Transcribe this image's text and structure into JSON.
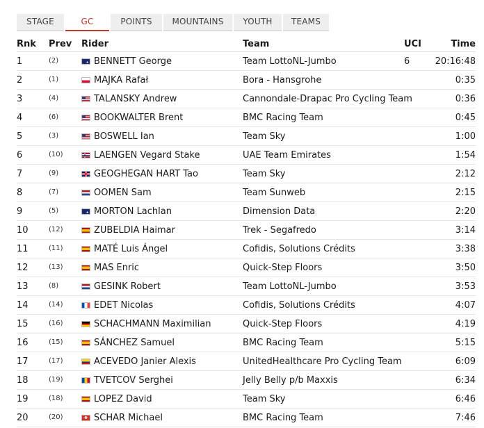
{
  "tabs": [
    {
      "label": "STAGE",
      "width": 68
    },
    {
      "label": "GC",
      "width": 63,
      "active": true
    },
    {
      "label": "POINTS",
      "width": 74
    },
    {
      "label": "MOUNTAINS",
      "width": 99
    },
    {
      "label": "YOUTH",
      "width": 69
    },
    {
      "label": "TEAMS",
      "width": 66
    }
  ],
  "columns": {
    "rnk": "Rnk",
    "prev": "Prev",
    "rider": "Rider",
    "team": "Team",
    "uci": "UCI",
    "time": "Time"
  },
  "rows": [
    {
      "rnk": "1",
      "prev": "(2)",
      "flag": "australia-flag-icon",
      "rider": "BENNETT George",
      "team": "Team LottoNL-Jumbo",
      "uci": "6",
      "time": "20:16:48"
    },
    {
      "rnk": "2",
      "prev": "(1)",
      "flag": "poland-flag-icon",
      "rider": "MAJKA Rafał",
      "team": "Bora - Hansgrohe",
      "uci": "",
      "time": "0:35"
    },
    {
      "rnk": "3",
      "prev": "(4)",
      "flag": "usa-flag-icon",
      "rider": "TALANSKY Andrew",
      "team": "Cannondale-Drapac Pro Cycling Team",
      "uci": "",
      "time": "0:36"
    },
    {
      "rnk": "4",
      "prev": "(6)",
      "flag": "usa-flag-icon",
      "rider": "BOOKWALTER Brent",
      "team": "BMC Racing Team",
      "uci": "",
      "time": "0:45"
    },
    {
      "rnk": "5",
      "prev": "(3)",
      "flag": "usa-flag-icon",
      "rider": "BOSWELL Ian",
      "team": "Team Sky",
      "uci": "",
      "time": "1:00"
    },
    {
      "rnk": "6",
      "prev": "(10)",
      "flag": "norway-flag-icon",
      "rider": "LAENGEN Vegard Stake",
      "team": "UAE Team Emirates",
      "uci": "",
      "time": "1:54"
    },
    {
      "rnk": "7",
      "prev": "(9)",
      "flag": "uk-flag-icon",
      "rider": "GEOGHEGAN HART Tao",
      "team": "Team Sky",
      "uci": "",
      "time": "2:12"
    },
    {
      "rnk": "8",
      "prev": "(7)",
      "flag": "netherlands-flag-icon",
      "rider": "OOMEN Sam",
      "team": "Team Sunweb",
      "uci": "",
      "time": "2:15"
    },
    {
      "rnk": "9",
      "prev": "(5)",
      "flag": "australia-flag-icon",
      "rider": "MORTON Lachlan",
      "team": "Dimension Data",
      "uci": "",
      "time": "2:20"
    },
    {
      "rnk": "10",
      "prev": "(12)",
      "flag": "spain-flag-icon",
      "rider": "ZUBELDIA Haimar",
      "team": "Trek - Segafredo",
      "uci": "",
      "time": "3:14"
    },
    {
      "rnk": "11",
      "prev": "(11)",
      "flag": "spain-flag-icon",
      "rider": "MATÉ Luis Ángel",
      "team": "Cofidis, Solutions Crédits",
      "uci": "",
      "time": "3:38"
    },
    {
      "rnk": "12",
      "prev": "(13)",
      "flag": "spain-flag-icon",
      "rider": "MAS Enric",
      "team": "Quick-Step Floors",
      "uci": "",
      "time": "3:50"
    },
    {
      "rnk": "13",
      "prev": "(8)",
      "flag": "netherlands-flag-icon",
      "rider": "GESINK Robert",
      "team": "Team LottoNL-Jumbo",
      "uci": "",
      "time": "3:53"
    },
    {
      "rnk": "14",
      "prev": "(14)",
      "flag": "france-flag-icon",
      "rider": "EDET Nicolas",
      "team": "Cofidis, Solutions Crédits",
      "uci": "",
      "time": "4:07"
    },
    {
      "rnk": "15",
      "prev": "(16)",
      "flag": "germany-flag-icon",
      "rider": "SCHACHMANN Maximilian",
      "team": "Quick-Step Floors",
      "uci": "",
      "time": "4:19"
    },
    {
      "rnk": "16",
      "prev": "(15)",
      "flag": "spain-flag-icon",
      "rider": "SÁNCHEZ Samuel",
      "team": "BMC Racing Team",
      "uci": "",
      "time": "5:15"
    },
    {
      "rnk": "17",
      "prev": "(17)",
      "flag": "colombia-flag-icon",
      "rider": "ACEVEDO Janier Alexis",
      "team": "UnitedHealthcare Pro Cycling Team",
      "uci": "",
      "time": "6:09"
    },
    {
      "rnk": "18",
      "prev": "(19)",
      "flag": "moldova-flag-icon",
      "rider": "TVETCOV Serghei",
      "team": "Jelly Belly p/b Maxxis",
      "uci": "",
      "time": "6:34"
    },
    {
      "rnk": "19",
      "prev": "(18)",
      "flag": "spain-flag-icon",
      "rider": "LOPEZ David",
      "team": "Team Sky",
      "uci": "",
      "time": "6:46"
    },
    {
      "rnk": "20",
      "prev": "(20)",
      "flag": "switzerland-flag-icon",
      "rider": "SCHAR Michael",
      "team": "BMC Racing Team",
      "uci": "",
      "time": "7:46"
    }
  ],
  "colors": {
    "accent": "#c0392b",
    "tab_bg": "#eeeeee",
    "row_border": "#e3e3e3"
  }
}
